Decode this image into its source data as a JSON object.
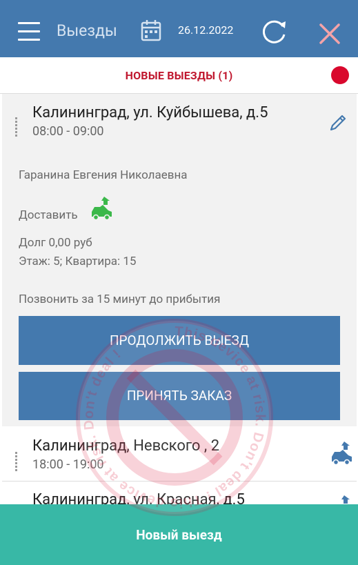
{
  "header": {
    "title": "Выезды",
    "date": "26.12.2022"
  },
  "section": {
    "label": "НОВЫЕ ВЫЕЗДЫ (1)"
  },
  "visits": [
    {
      "address": "Калининград, ул. Куйбышева, д.5",
      "time": "08:00 - 09:00",
      "client": "Гаранина Евгения Николаевна",
      "action": "Доставить",
      "debt": "Долг 0,00 руб",
      "floor": "Этаж: 5; Квартира: 15",
      "note": "Позвонить за 15 минут до прибытия",
      "continue_button": "ПРОДОЛЖИТЬ ВЫЕЗД",
      "accept_button": "ПРИНЯТЬ ЗАКАЗ"
    },
    {
      "address": "Калининград, Невского , 2",
      "time": "18:00 - 19:00"
    },
    {
      "address": "Калининград, ул. Красная, д.5"
    }
  ],
  "fab": {
    "label": "Новый выезд"
  },
  "watermark": {
    "text": "This device at risk. Don't deal ! This device at risk. Don't deal !"
  },
  "colors": {
    "appbar": "#4479ae",
    "accent_red": "#d9082d",
    "delivery_green": "#3bb84a",
    "fab": "#38b8a6",
    "close_icon": "#f4a3a8"
  }
}
